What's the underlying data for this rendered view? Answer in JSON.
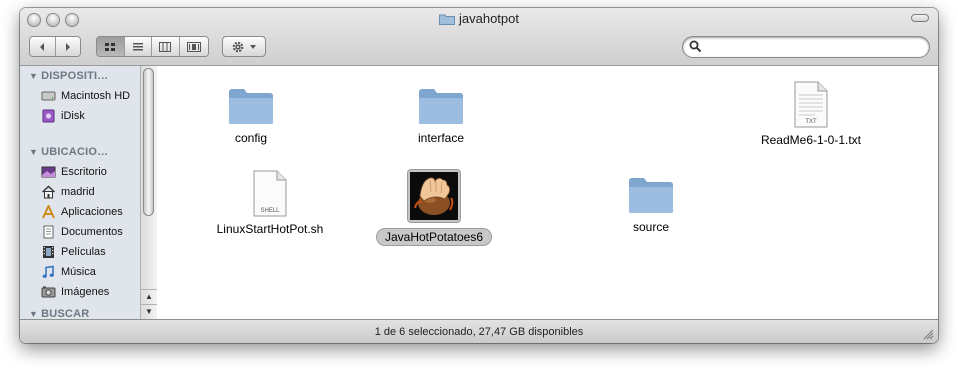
{
  "window": {
    "title": "javahotpot"
  },
  "toolbar": {
    "back_icon": "chevron-left-icon",
    "forward_icon": "chevron-right-icon",
    "view_modes": [
      "icon-view",
      "list-view",
      "column-view",
      "coverflow-view"
    ],
    "active_view": "icon-view",
    "action_icon": "gear-icon",
    "search": {
      "value": "",
      "placeholder": ""
    }
  },
  "sidebar": {
    "sections": [
      {
        "title": "DISPOSITI…",
        "items": [
          {
            "label": "Macintosh HD",
            "icon": "hard-drive-icon"
          },
          {
            "label": "iDisk",
            "icon": "idisk-icon"
          }
        ]
      },
      {
        "title": "UBICACIO…",
        "items": [
          {
            "label": "Escritorio",
            "icon": "desktop-icon"
          },
          {
            "label": "madrid",
            "icon": "home-icon"
          },
          {
            "label": "Aplicaciones",
            "icon": "applications-icon"
          },
          {
            "label": "Documentos",
            "icon": "documents-icon"
          },
          {
            "label": "Películas",
            "icon": "movies-icon"
          },
          {
            "label": "Música",
            "icon": "music-icon"
          },
          {
            "label": "Imágenes",
            "icon": "pictures-icon"
          }
        ]
      },
      {
        "title": "BUSCAR",
        "items": []
      }
    ]
  },
  "files": [
    {
      "name": "config",
      "kind": "folder",
      "selected": false
    },
    {
      "name": "interface",
      "kind": "folder",
      "selected": false
    },
    {
      "name": "ReadMe6-1-0-1.txt",
      "kind": "txt",
      "badge": "TXT",
      "selected": false
    },
    {
      "name": "LinuxStartHotPot.sh",
      "kind": "shell",
      "badge": "SHELL",
      "selected": false
    },
    {
      "name": "JavaHotPotatoes6",
      "kind": "app",
      "selected": true
    },
    {
      "name": "source",
      "kind": "folder",
      "selected": false
    }
  ],
  "status": {
    "text": "1 de 6 seleccionado, 27,47 GB disponibles"
  },
  "colors": {
    "sidebar_bg": "#e0e5ec",
    "sidebar_header": "#6f7882",
    "folder_blue": "#8fb2d4",
    "selection_gray": "#c8c8c8"
  }
}
